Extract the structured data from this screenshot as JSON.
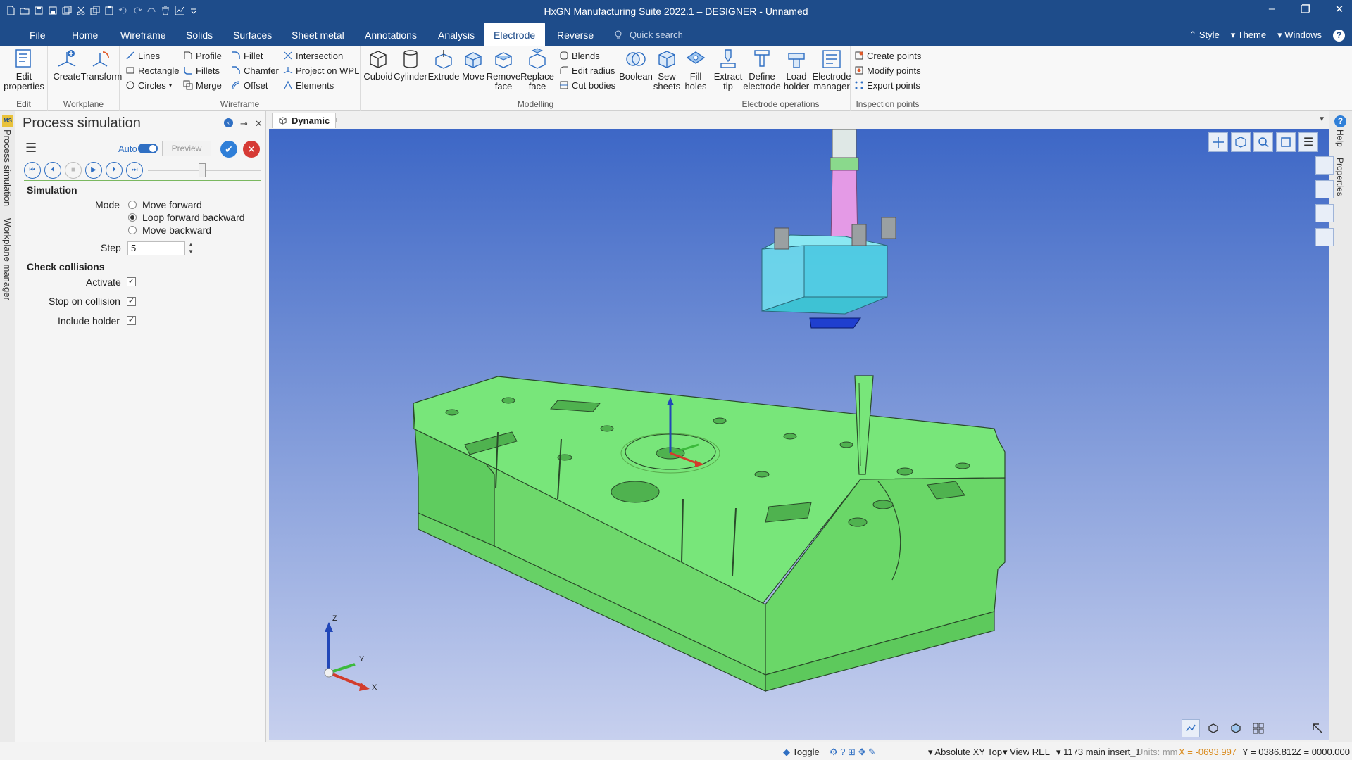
{
  "window": {
    "title": "HxGN Manufacturing Suite 2022.1 – DESIGNER - Unnamed"
  },
  "menu": {
    "tabs": [
      "File",
      "Home",
      "Wireframe",
      "Solids",
      "Surfaces",
      "Sheet metal",
      "Annotations",
      "Analysis",
      "Electrode",
      "Reverse"
    ],
    "active_tab": "Electrode",
    "quick_search_placeholder": "Quick search",
    "style": "Style",
    "theme": "Theme",
    "windows": "Windows"
  },
  "ribbon": {
    "edit": {
      "label": "Edit",
      "edit_properties": "Edit properties"
    },
    "workplane": {
      "label": "Workplane",
      "create": "Create",
      "transform": "Transform"
    },
    "wireframe": {
      "label": "Wireframe",
      "lines": "Lines",
      "rectangle": "Rectangle",
      "circles": "Circles",
      "profile": "Profile",
      "fillets": "Fillets",
      "merge": "Merge",
      "fillet": "Fillet",
      "chamfer": "Chamfer",
      "offset": "Offset",
      "intersection": "Intersection",
      "project_on_wpl": "Project on WPL",
      "elements": "Elements"
    },
    "modelling": {
      "label": "Modelling",
      "cuboid": "Cuboid",
      "cylinder": "Cylinder",
      "extrude": "Extrude",
      "move": "Move",
      "remove_face": "Remove face",
      "replace_face": "Replace face",
      "blends": "Blends",
      "edit_radius": "Edit radius",
      "cut_bodies": "Cut bodies",
      "boolean": "Boolean",
      "sew_sheets": "Sew sheets",
      "fill_holes": "Fill holes"
    },
    "electrode_operations": {
      "label": "Electrode operations",
      "extract_tip": "Extract tip",
      "define_electrode": "Define electrode",
      "load_holder": "Load holder",
      "electrode_manager": "Electrode manager"
    },
    "inspection_points": {
      "label": "Inspection points",
      "create_points": "Create points",
      "modify_points": "Modify points",
      "export_points": "Export points"
    }
  },
  "panel": {
    "title": "Process simulation",
    "side_tabs": [
      "Process simulation",
      "Workplane manager"
    ],
    "auto_label": "Auto",
    "preview_label": "Preview",
    "simulation_section": "Simulation",
    "mode_label": "Mode",
    "modes": [
      "Move forward",
      "Loop forward backward",
      "Move backward"
    ],
    "selected_mode": 1,
    "step_label": "Step",
    "step_value": "5",
    "collisions_section": "Check collisions",
    "activate_label": "Activate",
    "stop_label": "Stop on collision",
    "holder_label": "Include holder"
  },
  "viewport": {
    "tab_label": "Dynamic",
    "background_top": "#3d67c6",
    "background_bottom": "#c7d0ee",
    "part_color": "#6ee06a",
    "holder_color": "#4fd8e6"
  },
  "right_strip": {
    "help": "Help",
    "properties": "Properties"
  },
  "status": {
    "toggle": "Toggle",
    "coord_system": "Absolute XY Top",
    "view": "View REL",
    "element": "1173 main insert_1",
    "units": "Units: mm",
    "x": "X = -0693.997",
    "y": "Y = 0386.812",
    "z": "Z = 0000.000"
  },
  "axes": {
    "x": "X",
    "y": "Y",
    "z": "Z"
  }
}
